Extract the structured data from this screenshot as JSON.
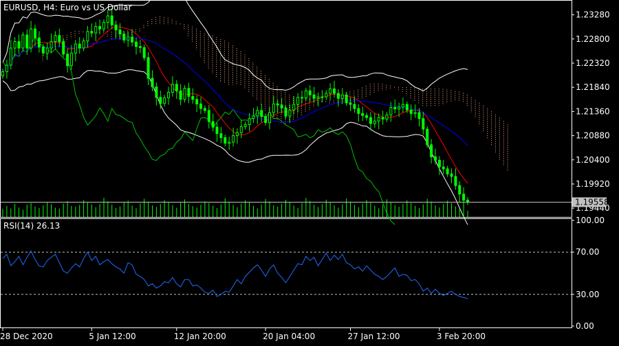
{
  "window": {
    "symbol_title": "EURUSD, H4:  Euro vs US Dollar",
    "rsi_title": "RSI(14) 26.13"
  },
  "colors": {
    "background": "#000000",
    "frame": "#ffffff",
    "bull_candle": "#00ff00",
    "bear_candle": "#00ff00",
    "volume": "#00ff00",
    "ma_fast": "#ff0000",
    "ma_slow": "#0000ff",
    "bollinger": "#ffffff",
    "chikou": "#00c000",
    "ichimoku_cloud": "#ffb08a",
    "rsi_line": "#1e6cff",
    "rsi_levels": "#c0c0c0",
    "price_line": "#c0c0c0",
    "last_price_bg": "#c0c0c0"
  },
  "chart_data": [
    {
      "type": "candlestick",
      "title": "EURUSD, H4:  Euro vs US Dollar",
      "x_tick_labels": [
        "28 Dec 2020",
        "5 Jan 12:00",
        "12 Jan 20:00",
        "20 Jan 04:00",
        "27 Jan 12:00",
        "3 Feb 20:00"
      ],
      "y_tick_labels": [
        "1.23280",
        "1.22800",
        "1.22320",
        "1.21840",
        "1.21360",
        "1.20880",
        "1.20400",
        "1.19920",
        "1.19440"
      ],
      "y_ticks": [
        1.2328,
        1.228,
        1.2232,
        1.2184,
        1.2136,
        1.2088,
        1.204,
        1.1992,
        1.1944
      ],
      "ylim": [
        1.1932,
        1.2352
      ],
      "last_price": 1.19558,
      "last_price_label": "1.19558",
      "grid": false,
      "series": [
        {
          "name": "close",
          "values": [
            1.2215,
            1.2228,
            1.2262,
            1.2275,
            1.2262,
            1.2288,
            1.2262,
            1.23,
            1.2282,
            1.2264,
            1.2252,
            1.2262,
            1.2275,
            1.2287,
            1.2275,
            1.225,
            1.2227,
            1.2252,
            1.227,
            1.2262,
            1.2276,
            1.2295,
            1.2292,
            1.2305,
            1.23,
            1.2313,
            1.2326,
            1.2308,
            1.2298,
            1.229,
            1.2278,
            1.2284,
            1.2274,
            1.2265,
            1.2263,
            1.2243,
            1.2202,
            1.2185,
            1.2164,
            1.2152,
            1.2163,
            1.2174,
            1.219,
            1.2177,
            1.216,
            1.2182,
            1.2166,
            1.216,
            1.2151,
            1.2142,
            1.2138,
            1.2116,
            1.2105,
            1.2092,
            1.2084,
            1.2073,
            1.2075,
            1.2088,
            1.2094,
            1.2106,
            1.211,
            1.2122,
            1.2127,
            1.2138,
            1.2126,
            1.2114,
            1.2134,
            1.2151,
            1.2149,
            1.2143,
            1.2127,
            1.2139,
            1.215,
            1.2164,
            1.2163,
            1.2177,
            1.2169,
            1.2162,
            1.2165,
            1.2165,
            1.2172,
            1.2181,
            1.2172,
            1.2162,
            1.2169,
            1.2153,
            1.215,
            1.2142,
            1.2132,
            1.2128,
            1.2124,
            1.2112,
            1.2117,
            1.2124,
            1.2121,
            1.2129,
            1.2144,
            1.2141,
            1.2145,
            1.215,
            1.2139,
            1.2132,
            1.2134,
            1.2122,
            1.2101,
            1.207,
            1.2046,
            1.2039,
            1.2026,
            1.2022,
            1.2012,
            1.2007,
            1.1989,
            1.1972,
            1.196,
            1.1956
          ]
        }
      ]
    },
    {
      "type": "bar",
      "title": "",
      "series": [
        {
          "name": "volume",
          "values": [
            38,
            52,
            40,
            61,
            45,
            34,
            58,
            66,
            49,
            42,
            55,
            71,
            60,
            44,
            39,
            63,
            75,
            52,
            48,
            57,
            80,
            68,
            59,
            46,
            62,
            91,
            74,
            58,
            43,
            50,
            69,
            77,
            54,
            41,
            64,
            86,
            72,
            55,
            47,
            61,
            79,
            70,
            56,
            44,
            67,
            83,
            62,
            51,
            45,
            58,
            74,
            66,
            53,
            42,
            60,
            88,
            71,
            57,
            46,
            63,
            79,
            68,
            52,
            40,
            59,
            85,
            73,
            56,
            49,
            62,
            81,
            69,
            54,
            43,
            65,
            90,
            76,
            58,
            47,
            61,
            82,
            70,
            55,
            44,
            60,
            87,
            72,
            57,
            46,
            63,
            80,
            67,
            53,
            41,
            58,
            84,
            71,
            56,
            48,
            62,
            78,
            66,
            52,
            42,
            59,
            86,
            73,
            55,
            45,
            61,
            77,
            64,
            50,
            40,
            57,
            30
          ]
        }
      ]
    },
    {
      "type": "line",
      "title": "RSI(14) 26.13",
      "y_tick_labels": [
        "100.00",
        "70.00",
        "30.00",
        "0.00"
      ],
      "y_ticks": [
        100,
        70,
        30,
        0
      ],
      "ylim": [
        0,
        100
      ],
      "levels": [
        70,
        30
      ],
      "series": [
        {
          "name": "RSI(14)",
          "values": [
            64,
            68,
            57,
            61,
            66,
            58,
            65,
            71,
            63,
            57,
            56,
            62,
            65,
            68,
            60,
            52,
            50,
            55,
            59,
            56,
            64,
            70,
            62,
            66,
            58,
            61,
            63,
            59,
            56,
            54,
            50,
            60,
            58,
            49,
            47,
            44,
            38,
            40,
            36,
            38,
            42,
            41,
            46,
            40,
            37,
            44,
            44,
            38,
            39,
            36,
            32,
            31,
            34,
            28,
            30,
            33,
            32,
            38,
            44,
            40,
            47,
            51,
            55,
            58,
            53,
            47,
            54,
            58,
            50,
            46,
            41,
            47,
            53,
            59,
            58,
            66,
            62,
            65,
            57,
            63,
            69,
            62,
            67,
            63,
            68,
            60,
            58,
            54,
            56,
            52,
            57,
            53,
            49,
            47,
            44,
            47,
            51,
            55,
            47,
            49,
            48,
            43,
            44,
            40,
            33,
            36,
            31,
            35,
            31,
            29,
            31,
            33,
            30,
            28,
            27,
            26
          ]
        }
      ]
    }
  ]
}
